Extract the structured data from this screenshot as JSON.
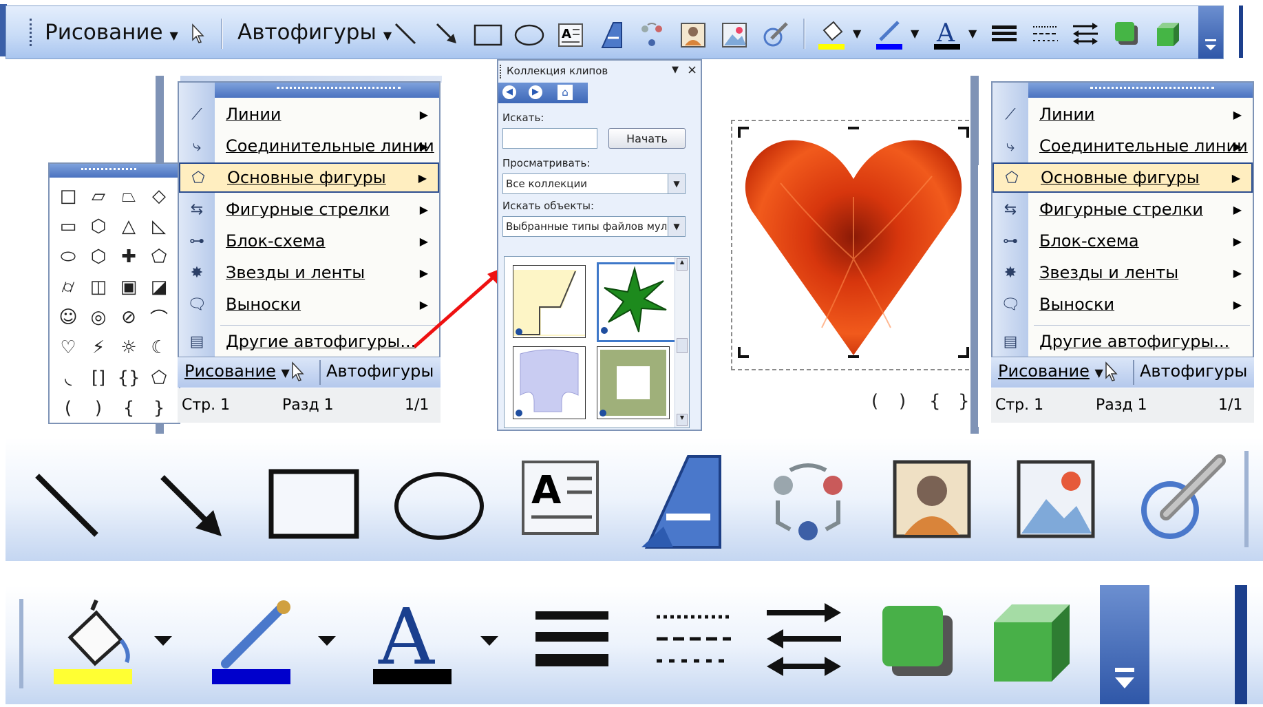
{
  "toolbar": {
    "drawing_label": "Рисование",
    "autoshapes_label": "Автофигуры",
    "icons": [
      "select-pointer-icon",
      "line-icon",
      "arrow-icon",
      "rectangle-icon",
      "oval-icon",
      "text-box-icon",
      "wordart-icon",
      "diagram-icon",
      "clipart-icon",
      "picture-icon",
      "ink-icon",
      "fill-color-icon",
      "line-color-icon",
      "font-color-icon",
      "line-style-icon",
      "dash-style-icon",
      "arrow-style-icon",
      "shadow-icon",
      "3d-icon",
      "toolbar-options-icon"
    ],
    "colors": {
      "fill": "#ffff00",
      "line": "#0000ff",
      "font": "#000000"
    }
  },
  "autoshapes_menu": {
    "items": [
      {
        "label": "Линии",
        "icon": "lines-icon"
      },
      {
        "label": "Соединительные линии",
        "icon": "connectors-icon"
      },
      {
        "label": "Основные фигуры",
        "icon": "basic-shapes-icon",
        "highlighted": true
      },
      {
        "label": "Фигурные стрелки",
        "icon": "block-arrows-icon"
      },
      {
        "label": "Блок-схема",
        "icon": "flowchart-icon"
      },
      {
        "label": "Звезды и ленты",
        "icon": "stars-banners-icon"
      },
      {
        "label": "Выноски",
        "icon": "callouts-icon"
      },
      {
        "label": "Другие автофигуры...",
        "icon": "more-autoshapes-icon"
      }
    ],
    "bottom_drawing": "Рисование",
    "bottom_autoshapes": "Автофигуры",
    "status": {
      "page": "Стр. 1",
      "section": "Разд 1",
      "pages": "1/1"
    }
  },
  "clip_panel": {
    "title": "Коллекция клипов",
    "search_label": "Искать:",
    "search_value": "",
    "go_button": "Начать",
    "browse_label": "Просматривать:",
    "browse_value": "Все коллекции",
    "objects_label": "Искать объекты:",
    "objects_value": "Выбранные типы файлов муль"
  },
  "shapes_palette": {
    "rows": [
      [
        "□",
        "▱",
        "⏢",
        "◇"
      ],
      [
        "▭",
        "⬡",
        "△",
        "◺"
      ],
      [
        "⬭",
        "⬡",
        "✚",
        "⬠"
      ],
      [
        "⌭",
        "◫",
        "▣",
        "◪"
      ],
      [
        "☺",
        "◎",
        "⊘",
        "⌒"
      ],
      [
        "♡",
        "⚡",
        "☼",
        "☾"
      ],
      [
        "◟",
        "[]",
        "{}",
        "⬠"
      ],
      [
        "(",
        ")",
        "{",
        "}"
      ]
    ]
  }
}
